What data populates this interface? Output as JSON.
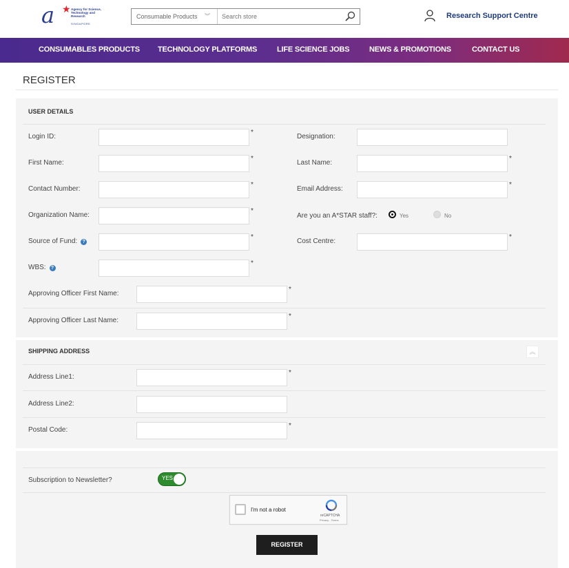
{
  "header": {
    "logo_agency": "Agency for Science, Technology and Research",
    "logo_country": "SINGAPORE",
    "search_category": "Consumable Products",
    "search_placeholder": "Search store",
    "account_label": "Research Support Centre"
  },
  "nav": {
    "items": [
      {
        "label": "CONSUMABLES PRODUCTS"
      },
      {
        "label": "TECHNOLOGY PLATFORMS"
      },
      {
        "label": "LIFE SCIENCE JOBS"
      },
      {
        "label": "NEWS & PROMOTIONS"
      },
      {
        "label": "CONTACT US"
      }
    ]
  },
  "page": {
    "title": "REGISTER"
  },
  "user_details": {
    "heading": "USER DETAILS",
    "login_id": {
      "label": "Login ID:",
      "value": ""
    },
    "designation": {
      "label": "Designation:",
      "value": ""
    },
    "first_name": {
      "label": "First Name:",
      "value": ""
    },
    "last_name": {
      "label": "Last Name:",
      "value": ""
    },
    "contact_number": {
      "label": "Contact Number:",
      "value": ""
    },
    "email": {
      "label": "Email Address:",
      "value": ""
    },
    "organization": {
      "label": "Organization Name:",
      "value": ""
    },
    "astar_staff": {
      "label": "Are you an A*STAR staff?:",
      "yes": "Yes",
      "no": "No",
      "selected": "Yes"
    },
    "source_of_fund": {
      "label": "Source of Fund:",
      "value": ""
    },
    "cost_centre": {
      "label": "Cost Centre:",
      "value": ""
    },
    "wbs": {
      "label": "WBS:",
      "value": ""
    },
    "approving_first": {
      "label": "Approving Officer First Name:",
      "value": ""
    },
    "approving_last": {
      "label": "Approving Officer Last Name:",
      "value": ""
    },
    "required_mark": "*",
    "help_glyph": "?"
  },
  "shipping": {
    "heading": "SHIPPING ADDRESS",
    "address1": {
      "label": "Address Line1:",
      "value": ""
    },
    "address2": {
      "label": "Address Line2:",
      "value": ""
    },
    "postal": {
      "label": "Postal Code:",
      "value": ""
    }
  },
  "subscription": {
    "label": "Subscription to Newsletter?",
    "toggle_text": "YES",
    "enabled": true
  },
  "captcha": {
    "label": "I'm not a robot",
    "brand": "reCAPTCHA",
    "terms": "Privacy - Terms"
  },
  "actions": {
    "register_label": "REGISTER"
  },
  "colors": {
    "nav_start": "#4a2a8e",
    "nav_end": "#a02a4e",
    "link": "#1f3b7a",
    "toggle_on": "#2e8b2e",
    "help": "#3a7bbf",
    "button": "#1e1e1e"
  }
}
